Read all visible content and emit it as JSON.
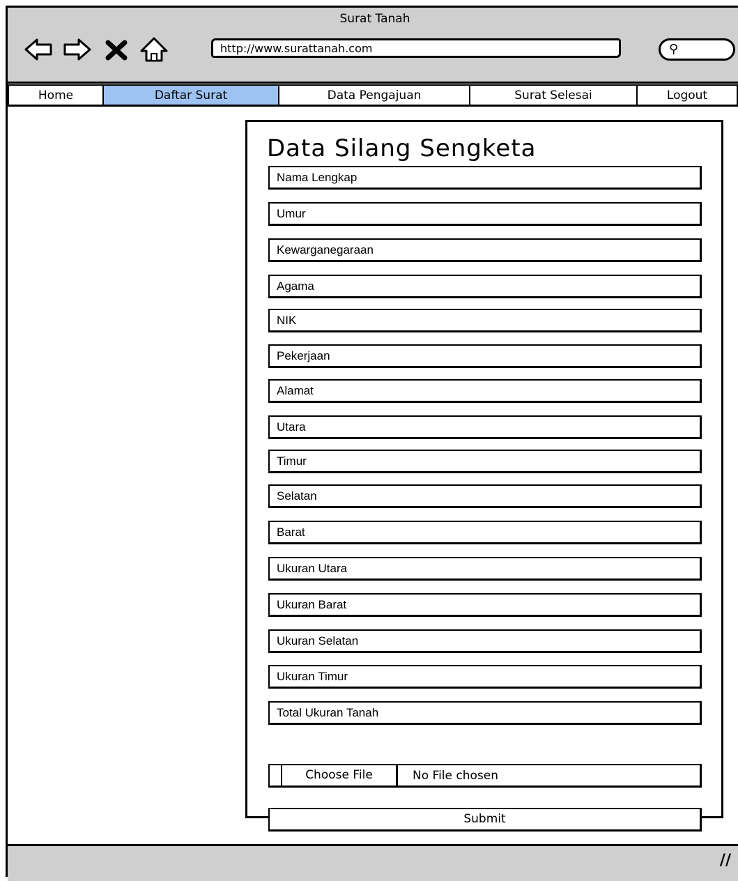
{
  "window": {
    "title": "Surat Tanah"
  },
  "toolbar": {
    "url": "http://www.surattanah.com",
    "icons": [
      "back-icon",
      "forward-icon",
      "stop-icon",
      "home-icon",
      "search-icon"
    ]
  },
  "nav": {
    "items": [
      {
        "label": "Home",
        "active": false
      },
      {
        "label": "Daftar Surat",
        "active": true
      },
      {
        "label": "Data Pengajuan",
        "active": false
      },
      {
        "label": "Surat Selesai",
        "active": false
      },
      {
        "label": "Logout",
        "active": false
      }
    ],
    "active_color": "#9ec3f2"
  },
  "form": {
    "title": "Data Silang Sengketa",
    "fields": [
      "Nama Lengkap",
      "Umur",
      "Kewarganegaraan",
      "Agama",
      "NIK",
      "Pekerjaan",
      "Alamat",
      "Utara",
      "Timur",
      "Selatan",
      "Barat",
      "Ukuran Utara",
      "Ukuran Barat",
      "Ukuran Selatan",
      "Ukuran Timur",
      "Total Ukuran Tanah"
    ],
    "file": {
      "button_label": "Choose File",
      "status": "No File chosen"
    },
    "submit_label": "Submit"
  }
}
